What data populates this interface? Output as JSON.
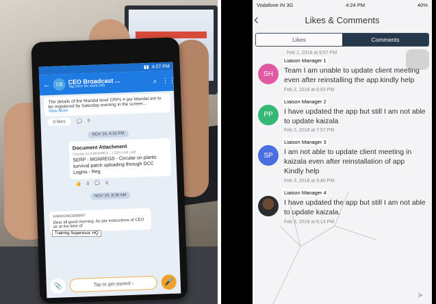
{
  "left": {
    "status_time": "4:07 PM",
    "header": {
      "back_icon": "arrow-left-icon",
      "avatar": "CB",
      "title": "CEO Broadcast ...",
      "subtitle": "Tap here for more info"
    },
    "preview_text": "The details of the Mandal level CRPs # per Mandal are to be registered by Saturday evening in the screen...",
    "view_more": "View More",
    "likes_label": "0 likes",
    "comments_count": "0",
    "date_1": "NOV 24, 6:33 PM",
    "document": {
      "title": "Document Attachment",
      "meta": "Circular no 9 MGNREG... | 320.5 KB | pdf",
      "body": "SERP - MGNREGS - Circular on plants survival patch uploading through DCC Logins - Reg"
    },
    "doc_likes": "0",
    "doc_comments": "0",
    "date_2": "NOV 25, 8:36 AM",
    "overlay_label": "Training Supervisor, HQ",
    "announcement": {
      "heading": "ANNOUNCEMENT",
      "text": "Dear all good morning. As per instructions of CEO sir at the time of"
    },
    "bottom_button": "Tap to get started"
  },
  "right": {
    "status": {
      "carrier": "Vodafone IN 3G",
      "time": "4:24 PM",
      "battery": "40%"
    },
    "title": "Likes & Comments",
    "tabs": [
      {
        "label": "Likes",
        "active": false
      },
      {
        "label": "Comments",
        "active": true
      }
    ],
    "top_date": "Feb 1, 2018 at 9:57 PM",
    "comments": [
      {
        "initials": "SH",
        "name": "Liaison Manager 1",
        "text": "Team I am unable to update client meeting  even after reinstalling the app.kindly help",
        "date": "Feb 2, 2018 at 6:03 PM",
        "color": "#e05aa3"
      },
      {
        "initials": "PP",
        "name": "Liaison Manager 2",
        "text": "I have updated the app but still I am not able to update kaizala",
        "date": "Feb 2, 2018 at 7:57 PM",
        "color": "#35b776"
      },
      {
        "initials": "SP",
        "name": "Liaison Manager 3",
        "text": "I am not able to update client meeting in kaizala even after reinstallation of app\nKindly help",
        "date": "Feb 3, 2018 at 5:40 PM",
        "color": "#4b6fe0"
      },
      {
        "initials": "",
        "name": "Liaison Manager 4",
        "text": "I have updated the app but still I am not able to update kaizala.",
        "date": "Feb 3, 2018 at 6:14 PM",
        "color": "#333333"
      }
    ]
  }
}
